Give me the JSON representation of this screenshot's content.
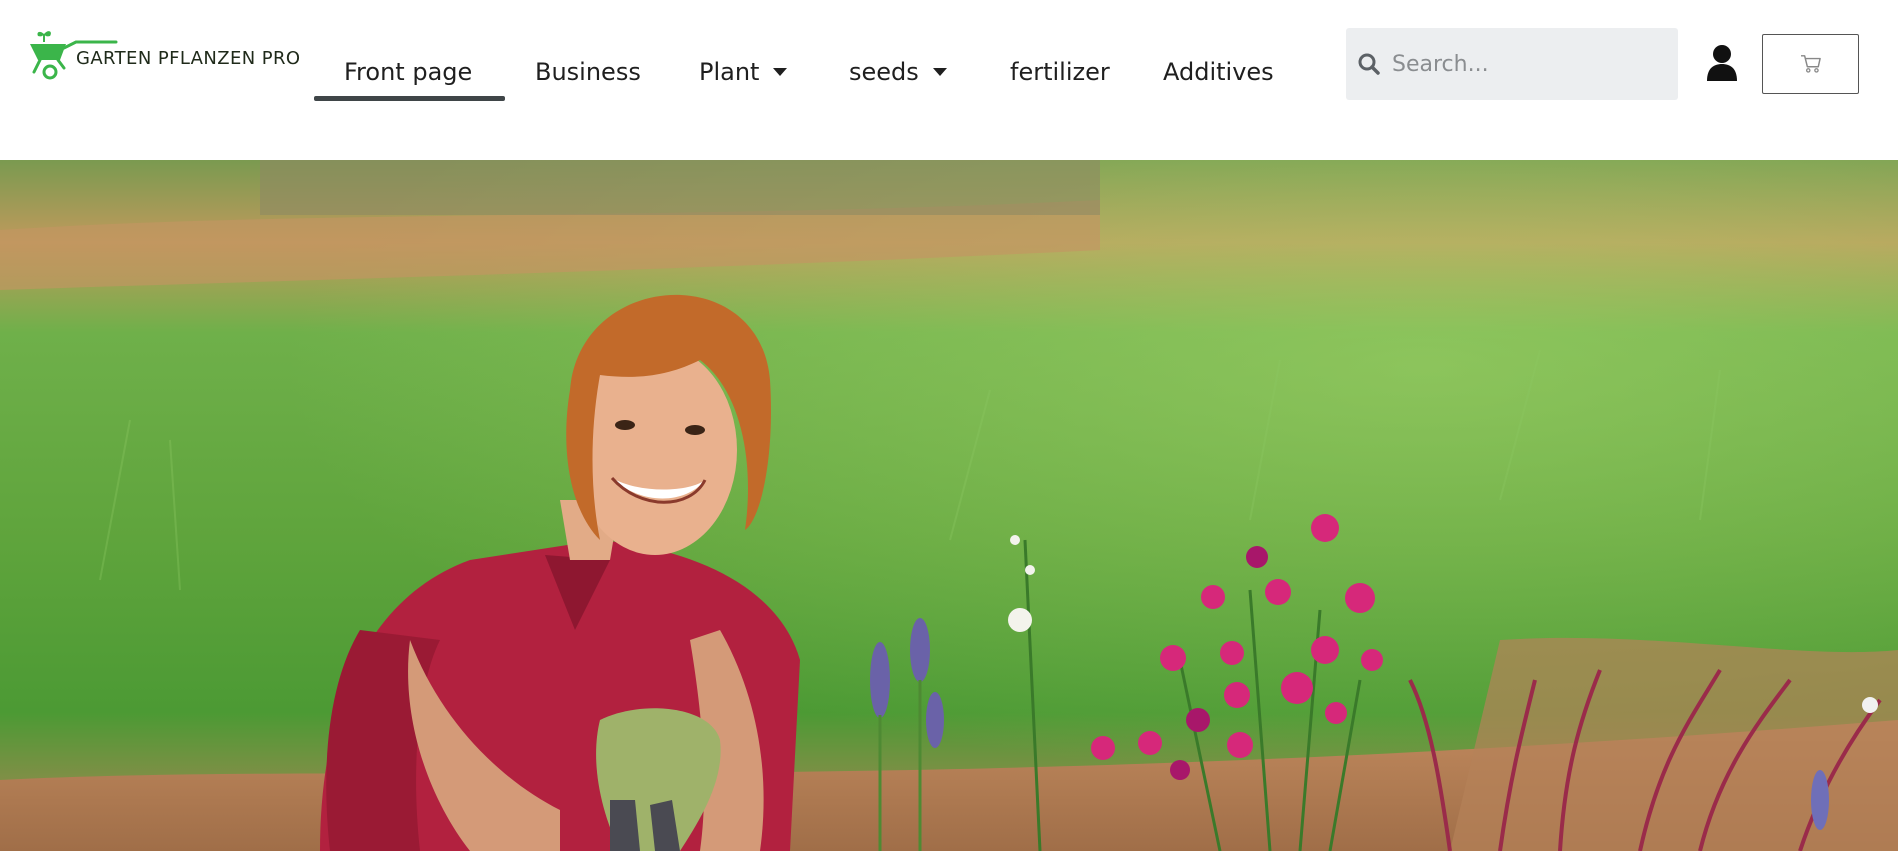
{
  "brand": {
    "name": "GARTEN PFLANZEN PRO",
    "logo_icon": "wheelbarrow-icon",
    "accent": "#3bb54a"
  },
  "nav": {
    "items": [
      {
        "label": "Front page",
        "active": true,
        "dropdown": false
      },
      {
        "label": "Business",
        "active": false,
        "dropdown": false
      },
      {
        "label": "Plant",
        "active": false,
        "dropdown": true
      },
      {
        "label": "seeds",
        "active": false,
        "dropdown": true
      },
      {
        "label": "fertilizer",
        "active": false,
        "dropdown": false
      },
      {
        "label": "Additives",
        "active": false,
        "dropdown": false
      }
    ]
  },
  "search": {
    "placeholder": "Search...",
    "value": "",
    "icon": "search-icon"
  },
  "account": {
    "icon": "user-icon"
  },
  "cart": {
    "icon": "cart-icon"
  },
  "hero": {
    "image": "gardener-kneeling-among-flowers"
  }
}
